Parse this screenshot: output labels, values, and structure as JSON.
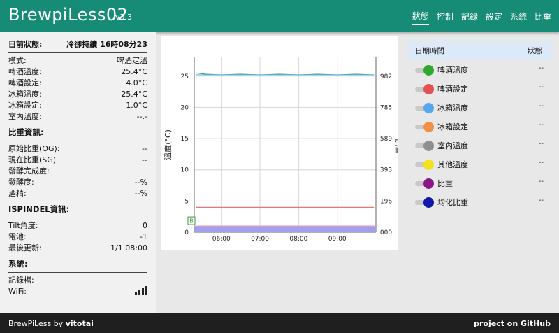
{
  "header": {
    "title": "BrewpiLess02",
    "version": "v3.3",
    "nav": [
      "狀態",
      "控制",
      "記錄",
      "設定",
      "系統",
      "比重"
    ]
  },
  "status": {
    "label": "目前狀態:",
    "value": "冷卻持續 16時08分23",
    "rows": [
      {
        "k": "模式:",
        "v": "啤酒定溫"
      },
      {
        "k": "啤酒溫度:",
        "v": "25.4°C"
      },
      {
        "k": "啤酒設定:",
        "v": "4.0°C"
      },
      {
        "k": "冰箱溫度:",
        "v": "25.4°C"
      },
      {
        "k": "冰箱設定:",
        "v": "1.0°C"
      },
      {
        "k": "室內溫度:",
        "v": "--.-"
      }
    ]
  },
  "gravity": {
    "title": "比重資訊:",
    "rows": [
      {
        "k": "原始比重(OG):",
        "v": "--"
      },
      {
        "k": "現在比重(SG)",
        "v": "--"
      },
      {
        "k": "發酵完成度:",
        "v": ""
      },
      {
        "k": "發酵度:",
        "v": "--%"
      },
      {
        "k": "酒精:",
        "v": "--%"
      }
    ]
  },
  "ispindel": {
    "title": "ISPINDEL資訊:",
    "rows": [
      {
        "k": "Tilt角度:",
        "v": "0"
      },
      {
        "k": "電池:",
        "v": "-1"
      },
      {
        "k": "最後更新:",
        "v": "1/1 08:00"
      }
    ]
  },
  "system": {
    "title": "系統:",
    "log_label": "記錄檔:",
    "wifi_label": "WiFi:",
    "wifi_bars": 4
  },
  "legend": {
    "header_time": "日期時間",
    "header_state": "狀態",
    "items": [
      {
        "label": "啤酒溫度",
        "color": "#2ea82e",
        "value": "--"
      },
      {
        "label": "啤酒設定",
        "color": "#e25252",
        "value": "--"
      },
      {
        "label": "冰箱溫度",
        "color": "#57a7ee",
        "value": "--"
      },
      {
        "label": "冰箱設定",
        "color": "#f0914a",
        "value": "--"
      },
      {
        "label": "室內溫度",
        "color": "#8f8f8f",
        "value": "--"
      },
      {
        "label": "其他溫度",
        "color": "#f2e21e",
        "value": "--"
      },
      {
        "label": "比重",
        "color": "#8a168a",
        "value": "--"
      },
      {
        "label": "均化比重",
        "color": "#0f18a8",
        "value": "--"
      }
    ]
  },
  "chart_data": {
    "type": "line",
    "xlabel": "",
    "ylabel": "溫度(°C)",
    "y2label": "比重",
    "ylim": [
      0,
      28
    ],
    "yticks": [
      0,
      5,
      10,
      15,
      20,
      25
    ],
    "y2ticks": [
      ".000",
      ".196",
      ".393",
      ".589",
      ".785",
      ".982"
    ],
    "xticks": [
      "06:00",
      "07:00",
      "08:00",
      "09:00"
    ],
    "x_hours": [
      5.3,
      10.0
    ],
    "grid": true,
    "marker_label": "B",
    "series": [
      {
        "color": "#2a9a7a",
        "values": [
          [
            5.35,
            25.5
          ],
          [
            5.6,
            25.3
          ],
          [
            6.0,
            25.2
          ],
          [
            6.5,
            25.3
          ],
          [
            7.0,
            25.2
          ],
          [
            7.5,
            25.3
          ],
          [
            8.0,
            25.2
          ],
          [
            8.5,
            25.3
          ],
          [
            9.0,
            25.2
          ],
          [
            9.5,
            25.3
          ],
          [
            9.95,
            25.2
          ]
        ]
      },
      {
        "color": "#7ab8ea",
        "values": [
          [
            5.35,
            25.2
          ],
          [
            9.95,
            25.2
          ]
        ]
      },
      {
        "color": "#d96a6a",
        "values": [
          [
            5.35,
            4.0
          ],
          [
            9.95,
            4.0
          ]
        ]
      },
      {
        "color": "#e79ab0",
        "values": [
          [
            5.35,
            1.0
          ],
          [
            9.95,
            1.0
          ]
        ]
      }
    ],
    "band": {
      "color": "#9fa0f0",
      "from": 0,
      "to": 1.0
    }
  },
  "footer": {
    "left_prefix": "BrewPiLess by ",
    "author": "vitotai",
    "right": "project on GitHub"
  }
}
